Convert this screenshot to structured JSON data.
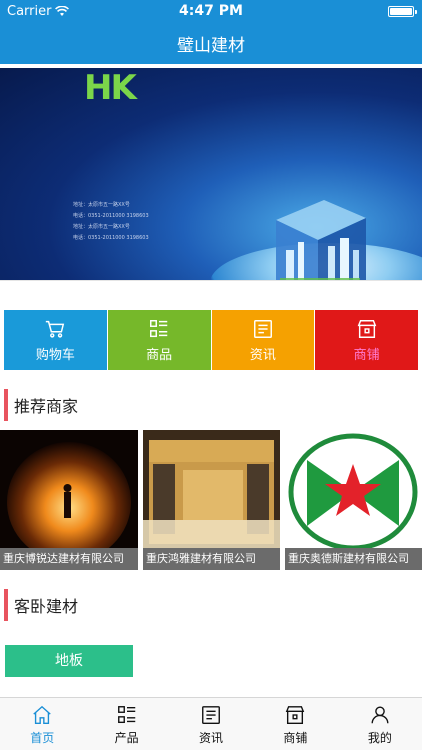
{
  "status": {
    "carrier": "Carrier",
    "time": "4:47 PM"
  },
  "nav": {
    "title": "璧山建材"
  },
  "banner": {
    "letters": "HK",
    "info_lines": [
      "地址：太原市五一路XX号",
      "电话：0351-2011000  3198603",
      "地址：太原市五一路XX号",
      "电话：0351-2011000  3198603"
    ],
    "slides": 2,
    "active_slide": 2
  },
  "categories": [
    {
      "label": "购物车",
      "icon": "cart-icon",
      "color": "#1a9ad9"
    },
    {
      "label": "商品",
      "icon": "grid-list-icon",
      "color": "#76b82a"
    },
    {
      "label": "资讯",
      "icon": "news-icon",
      "color": "#f5a101"
    },
    {
      "label": "商铺",
      "icon": "shop-icon",
      "color": "#e01818"
    }
  ],
  "sections": {
    "recommended": {
      "title": "推荐商家"
    },
    "bedroom": {
      "title": "客卧建材"
    }
  },
  "merchants": [
    {
      "name": "重庆博锐达建材有限公司",
      "image": "tunnel-photo"
    },
    {
      "name": "重庆鸿雅建材有限公司",
      "image": "box-photo"
    },
    {
      "name": "重庆奥德斯建材有限公司",
      "image": "star-logo"
    }
  ],
  "bedroom_items": [
    {
      "label": "地板"
    }
  ],
  "tabs": [
    {
      "label": "首页",
      "icon": "home-icon",
      "active": true
    },
    {
      "label": "产品",
      "icon": "grid-list-icon",
      "active": false
    },
    {
      "label": "资讯",
      "icon": "news-icon",
      "active": false
    },
    {
      "label": "商铺",
      "icon": "shop-icon",
      "active": false
    },
    {
      "label": "我的",
      "icon": "user-icon",
      "active": false
    }
  ],
  "colors": {
    "brand": "#1a8fd6",
    "accent_red": "#e8545f",
    "floor_button": "#2cbf8a"
  }
}
